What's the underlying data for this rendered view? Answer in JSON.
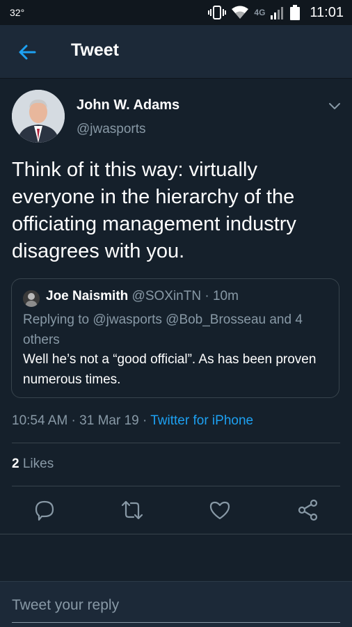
{
  "status_bar": {
    "temperature": "32°",
    "network": "4G",
    "time": "11:01"
  },
  "app_bar": {
    "title": "Tweet"
  },
  "tweet": {
    "author_name": "John W. Adams",
    "author_handle": "@jwasports",
    "text": "Think of it this way: virtually everyone in the hierarchy of the officiating management industry disagrees with you.",
    "quoted": {
      "name": "Joe Naismith",
      "meta": "@SOXinTN · 10m",
      "replying_to": "Replying to @jwasports @Bob_Brosseau and 4 others",
      "text": "Well he’s not a “good official”. As has been proven numerous times."
    },
    "timestamp": "10:54 AM · 31 Mar 19 · ",
    "source": "Twitter for iPhone",
    "likes_count": "2",
    "likes_label": "Likes"
  },
  "actions": {
    "icons": [
      "reply-icon",
      "retweet-icon",
      "like-icon",
      "share-icon"
    ]
  },
  "reply_bar": {
    "placeholder": "Tweet your reply"
  },
  "colors": {
    "background": "#15202b",
    "header": "#1c2938",
    "accent": "#1da1f2",
    "secondary_text": "#8899a6",
    "border": "#38444d"
  }
}
